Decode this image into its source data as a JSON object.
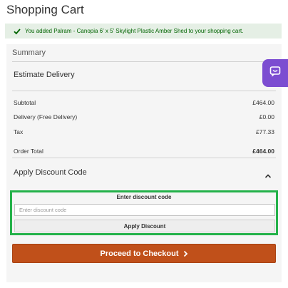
{
  "page": {
    "title": "Shopping Cart"
  },
  "message": {
    "text": "You added Palram - Canopia 6' x 5' Skylight Plastic Amber Shed to your shopping cart.",
    "icon": "check-icon",
    "color": "#006400"
  },
  "summary": {
    "title": "Summary",
    "estimate_label": "Estimate Delivery",
    "rows": [
      {
        "label": "Subtotal",
        "value": "£464.00"
      },
      {
        "label": "Delivery (Free Delivery)",
        "value": "£0.00"
      },
      {
        "label": "Tax",
        "value": "£77.33"
      }
    ],
    "total": {
      "label": "Order Total",
      "value": "£464.00"
    }
  },
  "discount": {
    "heading": "Apply Discount Code",
    "toggle_icon": "chevron-up-icon",
    "field_label": "Enter discount code",
    "placeholder": "Enter discount code",
    "value": "",
    "apply_label": "Apply Discount",
    "highlight_color": "#24b24a"
  },
  "checkout": {
    "label": "Proceed to Checkout",
    "icon": "chevron-right-icon",
    "color": "#c0501a"
  },
  "chat": {
    "icon": "chat-bubble-icon",
    "color": "#7c4dd1"
  }
}
